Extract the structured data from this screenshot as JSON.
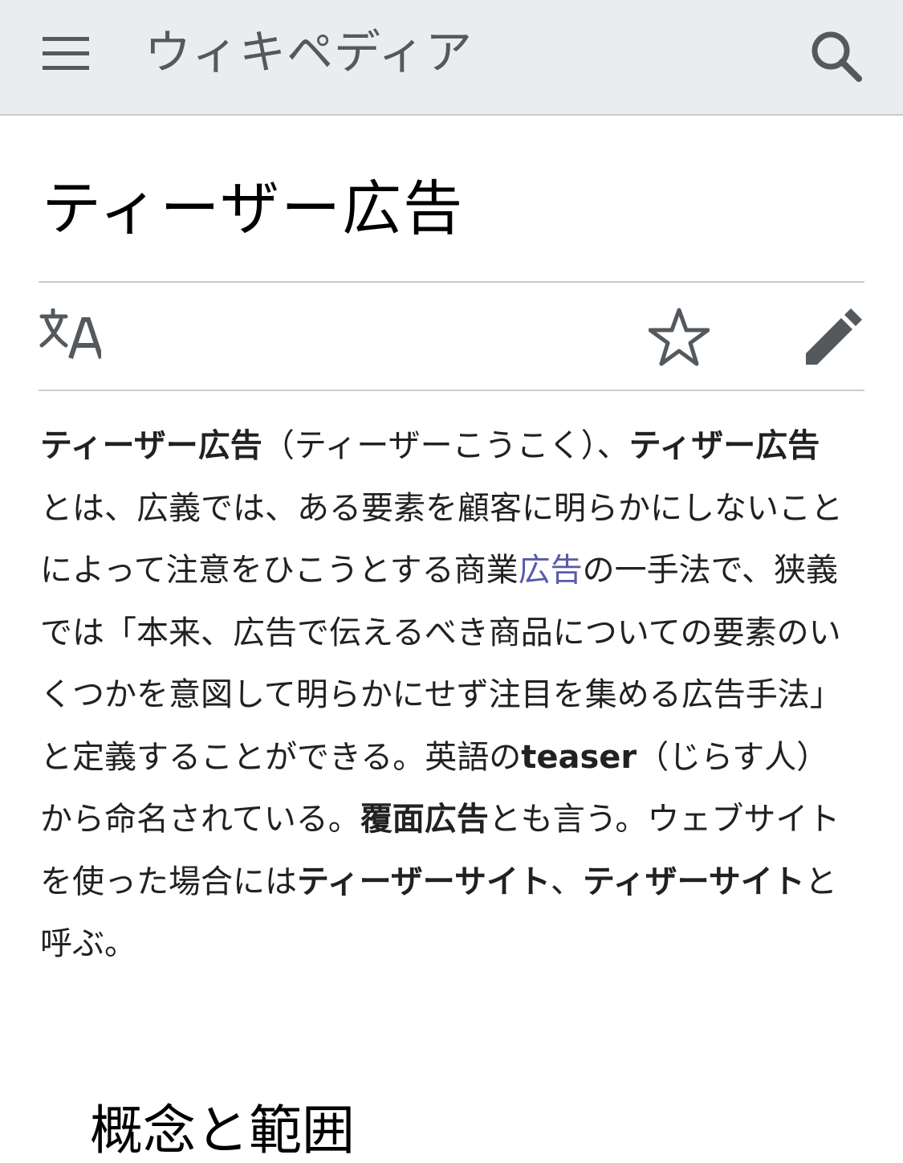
{
  "header": {
    "wordmark": "ウィキペディア",
    "menu_icon": "hamburger-menu-icon",
    "search_icon": "search-icon"
  },
  "page": {
    "title": "ティーザー広告",
    "actions": {
      "language_icon": "language-icon",
      "watch_icon": "star-icon",
      "edit_icon": "pencil-icon"
    }
  },
  "article": {
    "segments": [
      {
        "text": "ティーザー広告",
        "style": "bold"
      },
      {
        "text": "（ティーザーこうこく）、",
        "style": "normal"
      },
      {
        "text": "ティザー広告",
        "style": "bold"
      },
      {
        "text": "とは、広義では、ある要素を顧客に明らかにしないことによって注意をひこうとする商業",
        "style": "normal"
      },
      {
        "text": "広告",
        "style": "link"
      },
      {
        "text": "の一手法で、狭義では「本来、広告で伝えるべき商品についての要素のいくつかを意図して明らかにせず注目を集める広告手法」と定義することができる。英語の",
        "style": "normal"
      },
      {
        "text": "teaser",
        "style": "bold"
      },
      {
        "text": "（じらす人）から命名されている。",
        "style": "normal"
      },
      {
        "text": "覆面広告",
        "style": "bold"
      },
      {
        "text": "とも言う。ウェブサイトを使った場合には",
        "style": "normal"
      },
      {
        "text": "ティーザーサイト",
        "style": "bold"
      },
      {
        "text": "、",
        "style": "normal"
      },
      {
        "text": "ティザーサイト",
        "style": "bold"
      },
      {
        "text": "と呼ぶ。",
        "style": "normal"
      }
    ]
  },
  "section": {
    "heading": "概念と範囲"
  },
  "colors": {
    "header_bg": "#eaecf0",
    "divider": "#c8ccd1",
    "link": "#5a5aa8",
    "text": "#202122",
    "icon": "#54595d"
  }
}
